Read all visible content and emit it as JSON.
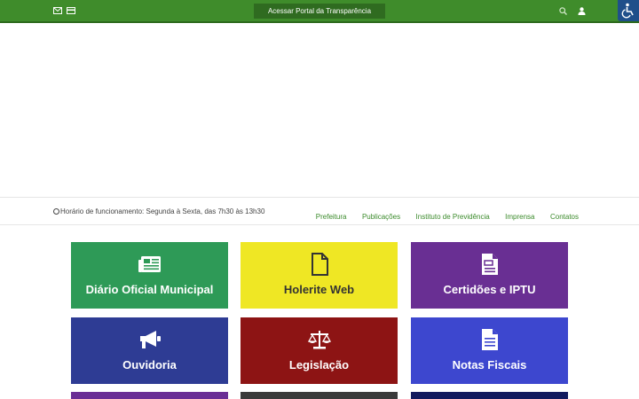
{
  "topbar": {
    "portal_button": "Acessar Portal da Transparência",
    "icons": [
      "mail-icon",
      "card-icon",
      "search-icon",
      "user-icon",
      "accessibility-icon"
    ]
  },
  "info": {
    "hours": "Horário de funcionamento: Segunda à Sexta, das 7h30 às 13h30"
  },
  "nav": {
    "items": [
      "Prefeitura",
      "Publicações",
      "Instituto de Previdência",
      "Imprensa",
      "Contatos"
    ]
  },
  "tiles": [
    {
      "label": "Diário Oficial Municipal",
      "icon": "newspaper-icon",
      "color": "#2e9a57"
    },
    {
      "label": "Holerite Web",
      "icon": "file-icon",
      "color": "#efe724"
    },
    {
      "label": "Certidões e IPTU",
      "icon": "document-icon",
      "color": "#692f93"
    },
    {
      "label": "Ouvidoria",
      "icon": "megaphone-icon",
      "color": "#2e3c94"
    },
    {
      "label": "Legislação",
      "icon": "scales-icon",
      "color": "#8d1414"
    },
    {
      "label": "Notas Fiscais",
      "icon": "invoice-icon",
      "color": "#3d47cf"
    }
  ],
  "partial_tile_colors": [
    "#6a2e95",
    "#3a3a3a",
    "#121a5e"
  ]
}
